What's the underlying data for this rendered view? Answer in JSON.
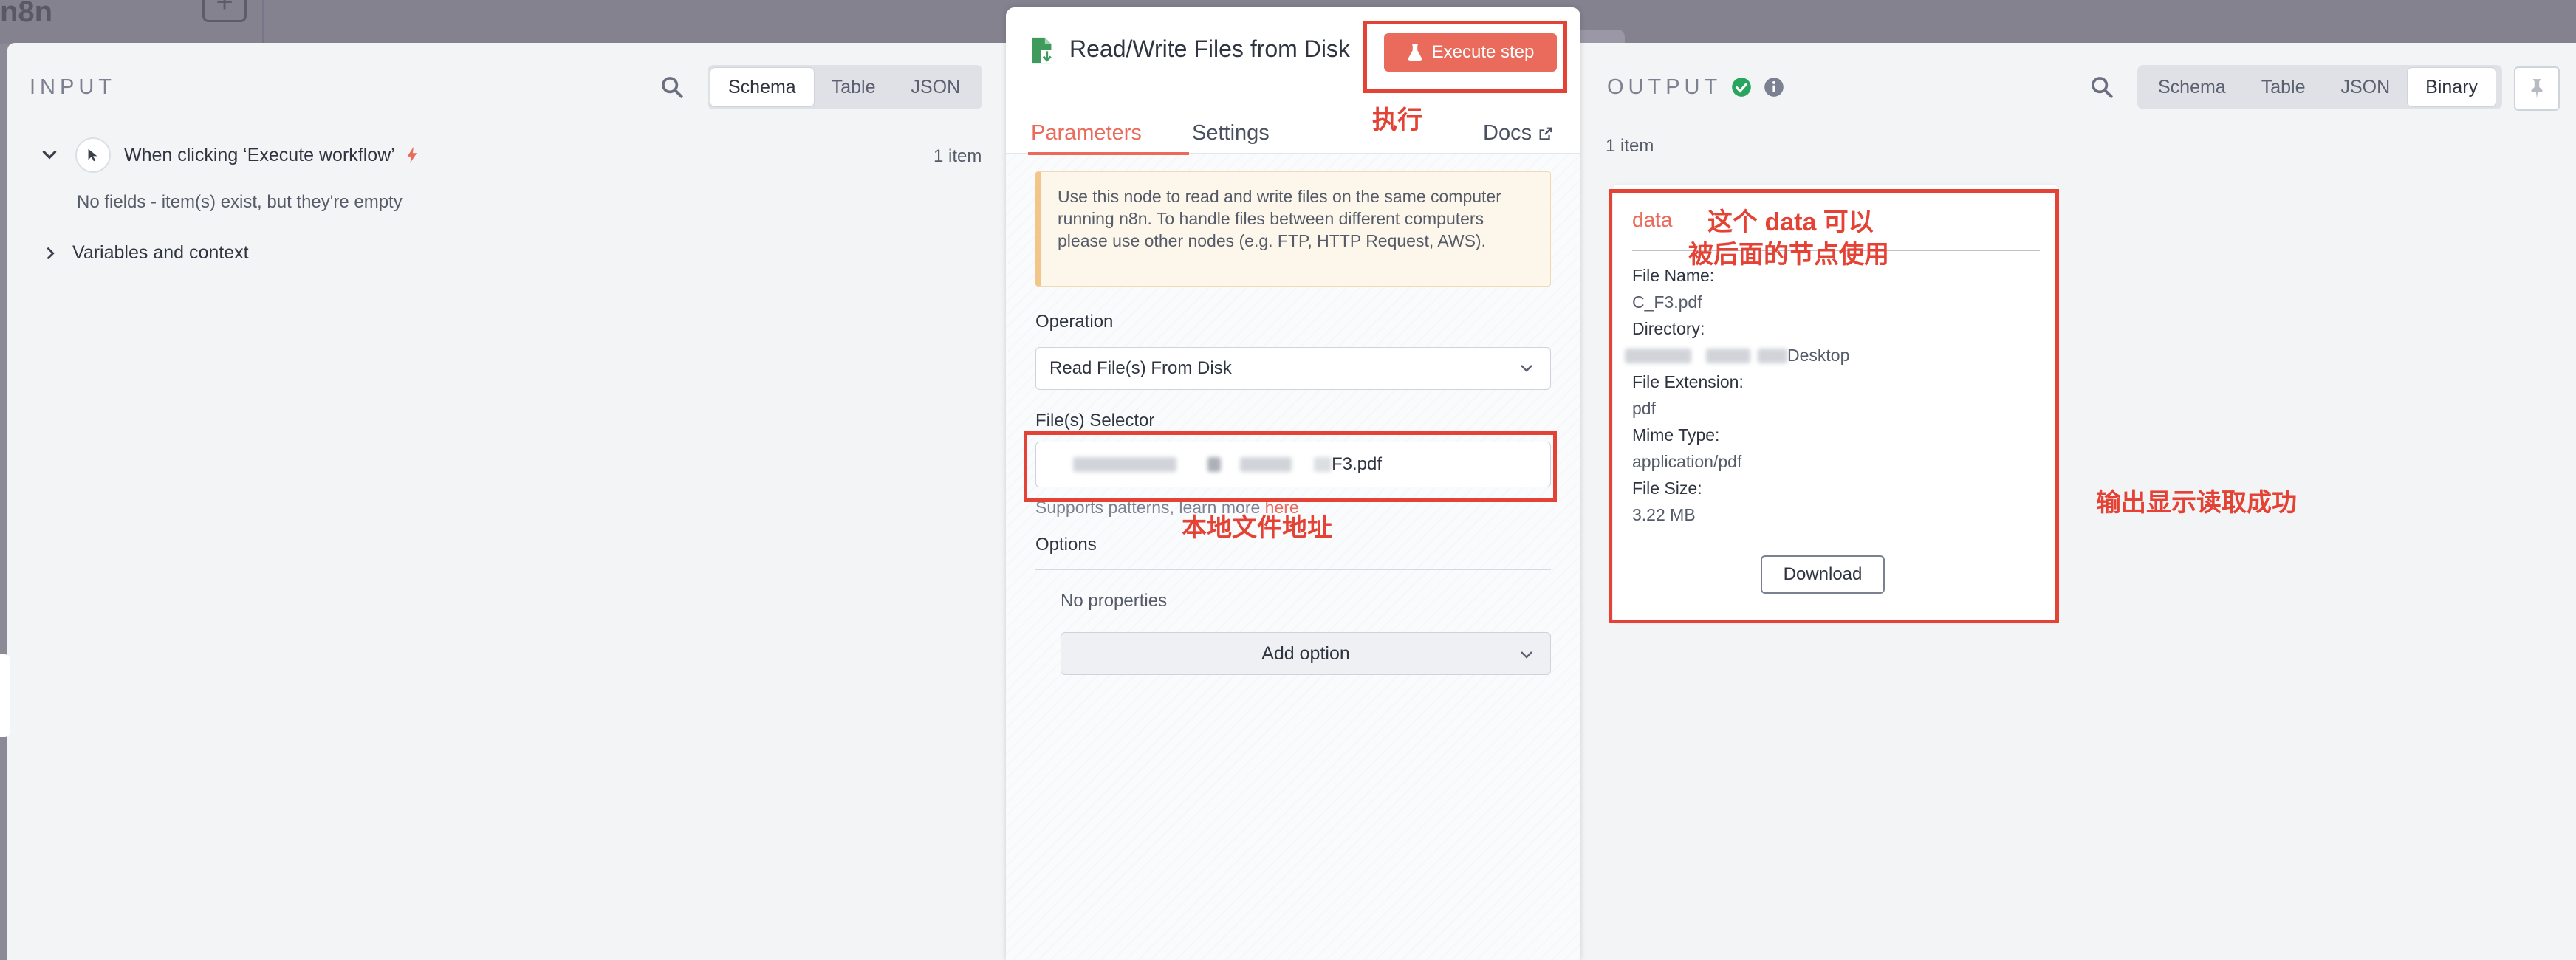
{
  "topbar": {
    "logo_text": "n8n",
    "plus": "+"
  },
  "input": {
    "title": "INPUT",
    "tabs": [
      "Schema",
      "Table",
      "JSON"
    ],
    "active_tab": "Schema",
    "trigger": {
      "label": "When clicking ‘Execute workflow’",
      "count": "1 item"
    },
    "empty_text": "No fields - item(s) exist, but they're empty",
    "variables_label": "Variables and context"
  },
  "node": {
    "title": "Read/Write Files from Disk",
    "execute_label": "Execute step",
    "tabs": {
      "parameters": "Parameters",
      "settings": "Settings",
      "docs": "Docs"
    },
    "notice": "Use this node to read and write files on the same computer running n8n. To handle files between different computers please use other nodes (e.g. FTP, HTTP Request, AWS).",
    "operation_label": "Operation",
    "operation_value": "Read File(s) From Disk",
    "selector_label": "File(s) Selector",
    "selector_value_suffix": "F3.pdf",
    "hint_prefix": "Supports patterns, learn more ",
    "hint_link": "here",
    "options_label": "Options",
    "no_properties": "No properties",
    "add_option": "Add option"
  },
  "output": {
    "title": "OUTPUT",
    "tabs": [
      "Schema",
      "Table",
      "JSON",
      "Binary"
    ],
    "active_tab": "Binary",
    "count": "1 item",
    "binary": {
      "title": "data",
      "file_name_label": "File Name:",
      "file_name": "C_F3.pdf",
      "directory_label": "Directory:",
      "directory_suffix": "Desktop",
      "extension_label": "File Extension:",
      "extension": "pdf",
      "mime_label": "Mime Type:",
      "mime": "application/pdf",
      "size_label": "File Size:",
      "size": "3.22 MB",
      "download": "Download"
    }
  },
  "annotations": {
    "execute": "执行",
    "data_line1": "这个 data 可以",
    "data_line2": "被后面的节点使用",
    "local_path": "本地文件地址",
    "output_success": "输出显示读取成功"
  },
  "colors": {
    "accent": "#ea6b5b",
    "annotation": "#e34234",
    "success": "#2aa55f"
  }
}
